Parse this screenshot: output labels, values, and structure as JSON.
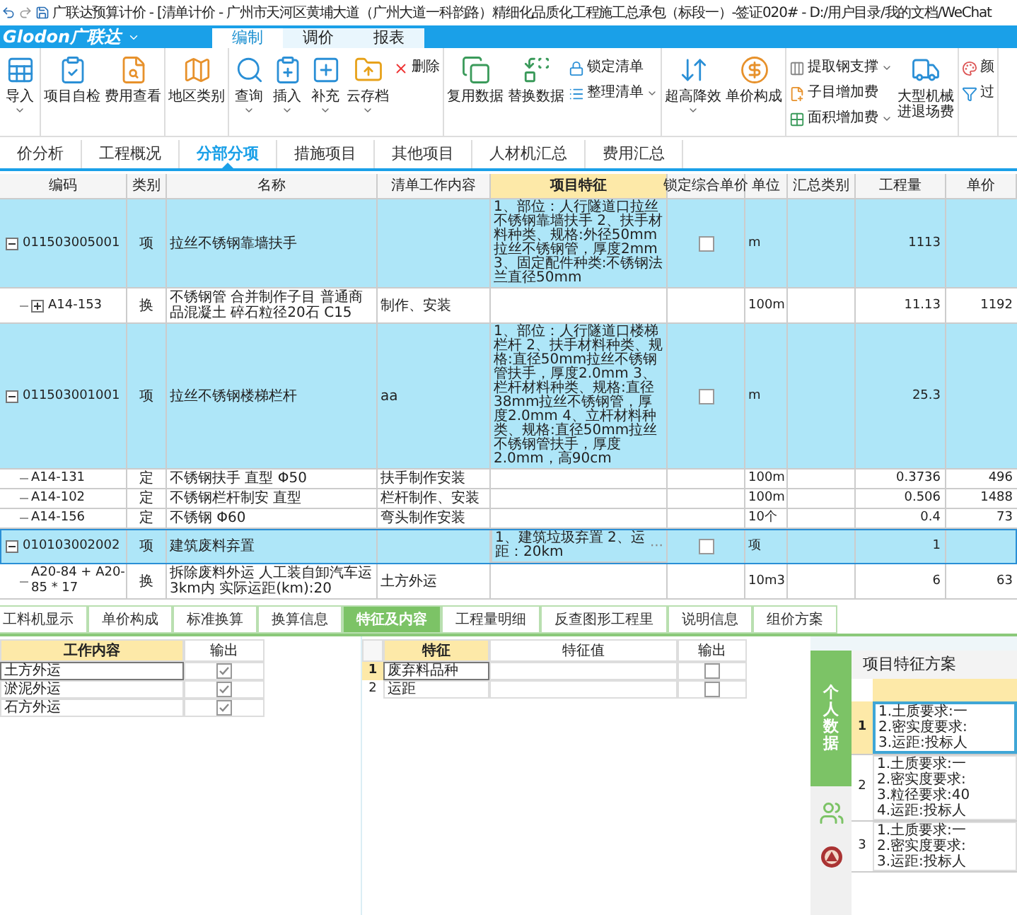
{
  "title_bar": {
    "title": "广联达预算计价 - [清单计价 - 广州市天河区黄埔大道（广州大道一科韵路）精细化品质化工程施工总承包（标段一）-签证020# - D:/用户目录/我的文档/WeChat"
  },
  "app_bar": {
    "logo": "Glodon广联达",
    "tabs": [
      {
        "label": "编制",
        "selected": true
      },
      {
        "label": "调价",
        "selected": false
      },
      {
        "label": "报表",
        "selected": false
      }
    ]
  },
  "ribbon": {
    "groups": [
      {
        "items": [
          {
            "kind": "large",
            "label": "导入",
            "caret": true
          }
        ]
      },
      {
        "items": [
          {
            "kind": "large",
            "label": "项目自检",
            "caret": false
          },
          {
            "kind": "large",
            "label": "费用查看",
            "caret": false
          }
        ]
      },
      {
        "items": [
          {
            "kind": "large",
            "label": "地区类别",
            "caret": false
          }
        ]
      },
      {
        "items": [
          {
            "kind": "large",
            "label": "查询",
            "caret": true
          },
          {
            "kind": "large",
            "label": "插入",
            "caret": true
          },
          {
            "kind": "large",
            "label": "补充",
            "caret": true
          },
          {
            "kind": "large",
            "label": "云存档",
            "caret": true
          },
          {
            "kind": "stack",
            "entries": [
              {
                "label": "删除",
                "caret": false
              }
            ]
          }
        ]
      },
      {
        "items": [
          {
            "kind": "large",
            "label": "复用数据",
            "caret": false
          },
          {
            "kind": "large",
            "label": "替换数据",
            "caret": false
          },
          {
            "kind": "stack",
            "entries": [
              {
                "label": "锁定清单",
                "caret": false
              },
              {
                "label": "整理清单",
                "caret": true
              }
            ]
          }
        ]
      },
      {
        "items": [
          {
            "kind": "large",
            "label": "超高降效",
            "caret": true
          },
          {
            "kind": "large",
            "label": "单价构成",
            "caret": false
          }
        ]
      },
      {
        "items": [
          {
            "kind": "stack",
            "entries": [
              {
                "label": "提取钢支撑",
                "caret": true
              },
              {
                "label": "子目增加费",
                "caret": false
              },
              {
                "label": "面积增加费",
                "caret": true
              }
            ]
          },
          {
            "kind": "large",
            "label": "大型机械进退场费",
            "caret": false
          }
        ]
      },
      {
        "items": [
          {
            "kind": "stack",
            "entries": [
              {
                "label": "颜",
                "caret": false
              },
              {
                "label": "过",
                "caret": false
              }
            ]
          }
        ]
      }
    ]
  },
  "view_tabs": [
    {
      "label": "价分析",
      "selected": false
    },
    {
      "label": "工程概况",
      "selected": false
    },
    {
      "label": "分部分项",
      "selected": true
    },
    {
      "label": "措施项目",
      "selected": false
    },
    {
      "label": "其他项目",
      "selected": false
    },
    {
      "label": "人材机汇总",
      "selected": false
    },
    {
      "label": "费用汇总",
      "selected": false
    }
  ],
  "table": {
    "columns": [
      "编码",
      "类别",
      "名称",
      "清单工作内容",
      "项目特征",
      "锁定综合单价",
      "单位",
      "汇总类别",
      "工程量",
      "单价"
    ],
    "rows": [
      {
        "kind": "item",
        "code": "011503005001",
        "type": "项",
        "name": "拉丝不锈钢靠墙扶手",
        "features": "1、部位：人行隧道口拉丝不锈钢靠墙扶手 2、扶手材料种类、规格:外径50mm拉丝不锈钢管，厚度2mm 3、固定配件种类:不锈钢法兰直径50mm",
        "locked": false,
        "unit": "m",
        "quantity": "1113",
        "selected": false,
        "expanded": true,
        "children": [
          {
            "kind": "quota",
            "code": "A14-153",
            "type": "换",
            "name": "不锈钢管 合并制作子目 普通商品混凝土 碎石粒径20石 C15",
            "work": "制作、安装",
            "unit": "100m",
            "quantity": "11.13",
            "price": "1192",
            "selected": false,
            "expanded": false
          }
        ]
      },
      {
        "kind": "item",
        "code": "011503001001",
        "type": "项",
        "name": "拉丝不锈钢楼梯栏杆",
        "work": "aa",
        "features": "1、部位：人行隧道口楼梯栏杆 2、扶手材料种类、规格:直径50mm拉丝不锈钢管扶手，厚度2.0mm 3、栏杆材料种类、规格:直径38mm拉丝不锈钢管，厚度2.0mm 4、立杆材料种类、规格:直径50mm拉丝不锈钢管扶手，厚度2.0mm，高90cm",
        "locked": false,
        "unit": "m",
        "quantity": "25.3",
        "selected": false,
        "expanded": true,
        "children": [
          {
            "kind": "quota",
            "code": "A14-131",
            "type": "定",
            "name": "不锈钢扶手 直型 Φ50",
            "work": "扶手制作安装",
            "unit": "100m",
            "quantity": "0.3736",
            "price": "496",
            "selected": false
          },
          {
            "kind": "quota",
            "code": "A14-102",
            "type": "定",
            "name": "不锈钢栏杆制安 直型",
            "work": "栏杆制作、安装",
            "unit": "100m",
            "quantity": "0.506",
            "price": "1488",
            "selected": false
          },
          {
            "kind": "quota",
            "code": "A14-156",
            "type": "定",
            "name": "不锈钢 Φ60",
            "work": "弯头制作安装",
            "unit": "10个",
            "quantity": "0.4",
            "price": "73",
            "selected": false
          }
        ]
      },
      {
        "kind": "item",
        "code": "010103002002",
        "type": "项",
        "name": "建筑废料弃置",
        "features": "1、建筑垃圾弃置 2、运距：20km",
        "feature_button": "···",
        "locked": false,
        "unit": "项",
        "quantity": "1",
        "selected": true,
        "expanded": true,
        "children": [
          {
            "kind": "quota",
            "code": "A20-84 + A20-85 * 17",
            "type": "换",
            "name": "拆除废料外运 人工装自卸汽车运 3km内 实际运距(km):20",
            "work": "土方外运",
            "unit": "10m3",
            "quantity": "6",
            "price": "63",
            "selected": false
          }
        ]
      }
    ]
  },
  "detail_tabs": [
    {
      "label": "工料机显示",
      "selected": false
    },
    {
      "label": "单价构成",
      "selected": false
    },
    {
      "label": "标准换算",
      "selected": false
    },
    {
      "label": "换算信息",
      "selected": false
    },
    {
      "label": "特征及内容",
      "selected": true
    },
    {
      "label": "工程量明细",
      "selected": false
    },
    {
      "label": "反查图形工程里",
      "selected": false
    },
    {
      "label": "说明信息",
      "selected": false
    },
    {
      "label": "组价方案",
      "selected": false
    }
  ],
  "work_content": {
    "columns": [
      "工作内容",
      "输出"
    ],
    "rows": [
      {
        "text": "土方外运",
        "checked": true,
        "selected": true
      },
      {
        "text": "淤泥外运",
        "checked": true,
        "selected": false
      },
      {
        "text": "石方外运",
        "checked": true,
        "selected": false
      }
    ]
  },
  "features": {
    "columns": [
      "特征",
      "特征值",
      "输出"
    ],
    "rows": [
      {
        "index": "1",
        "name": "废弃料品种",
        "checked": false,
        "selected": true
      },
      {
        "index": "2",
        "name": "运距",
        "checked": false,
        "selected": false
      }
    ]
  },
  "side_panel": {
    "tab_label": "个人数据",
    "title": "项目特征方案",
    "items": [
      {
        "index": "1",
        "lines": [
          "1.土质要求:一",
          "2.密实度要求:",
          "3.运距:投标人"
        ],
        "selected": true
      },
      {
        "index": "2",
        "lines": [
          "1.土质要求:一",
          "2.密实度要求:",
          "3.粒径要求:40",
          "4.运距:投标人"
        ],
        "selected": false
      },
      {
        "index": "3",
        "lines": [
          "1.土质要求:一",
          "2.密实度要求:",
          "3.运距:投标人"
        ],
        "selected": false
      }
    ]
  }
}
